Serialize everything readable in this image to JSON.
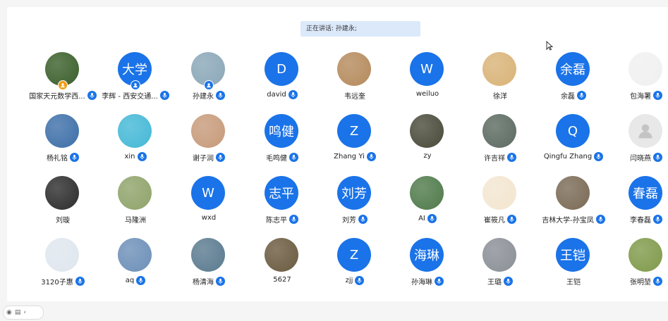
{
  "banner": {
    "speaking_text": "正在讲话: 孙建永;"
  },
  "participants": [
    {
      "name": "国家天元数学西...",
      "avatar_text": "",
      "bg": "#3a5f2a",
      "mic": true,
      "badge": "orange"
    },
    {
      "name": "李辉 - 西安交通...",
      "avatar_text": "大学",
      "bg": "#1a73e8",
      "mic": true,
      "badge": "blue"
    },
    {
      "name": "孙建永",
      "avatar_text": "",
      "bg": "#8aa7b8",
      "mic": true,
      "badge": "blue"
    },
    {
      "name": "david",
      "avatar_text": "D",
      "bg": "#1a73e8",
      "mic": true
    },
    {
      "name": "韦远奎",
      "avatar_text": "",
      "bg": "#b58a5c",
      "mic": false
    },
    {
      "name": "weiluo",
      "avatar_text": "W",
      "bg": "#1a73e8",
      "mic": false
    },
    {
      "name": "徐洋",
      "avatar_text": "",
      "bg": "#d9b377",
      "mic": false
    },
    {
      "name": "余磊",
      "avatar_text": "余磊",
      "bg": "#1a73e8",
      "mic": true
    },
    {
      "name": "包海署",
      "avatar_text": "",
      "bg": "#f0f0f0",
      "mic": true
    },
    {
      "name": "杨礼铭",
      "avatar_text": "",
      "bg": "#3d6fa8",
      "mic": true
    },
    {
      "name": "xin",
      "avatar_text": "",
      "bg": "#44b8d6",
      "mic": true
    },
    {
      "name": "谢子润",
      "avatar_text": "",
      "bg": "#c79a7a",
      "mic": true
    },
    {
      "name": "毛鸣健",
      "avatar_text": "鸣健",
      "bg": "#1a73e8",
      "mic": true
    },
    {
      "name": "Zhang Yi",
      "avatar_text": "Z",
      "bg": "#1a73e8",
      "mic": true
    },
    {
      "name": "zy",
      "avatar_text": "",
      "bg": "#4a4a3a",
      "mic": false
    },
    {
      "name": "许吉祥",
      "avatar_text": "",
      "bg": "#5b6a60",
      "mic": true
    },
    {
      "name": "Qingfu Zhang",
      "avatar_text": "Q",
      "bg": "#1a73e8",
      "mic": true
    },
    {
      "name": "闫晓燕",
      "avatar_text": "",
      "bg": "#e8e8e8",
      "mic": true
    },
    {
      "name": "刘璇",
      "avatar_text": "",
      "bg": "#2c2c2c",
      "mic": false
    },
    {
      "name": "马隆洲",
      "avatar_text": "",
      "bg": "#8fa36a",
      "mic": false
    },
    {
      "name": "wxd",
      "avatar_text": "W",
      "bg": "#1a73e8",
      "mic": false
    },
    {
      "name": "陈志平",
      "avatar_text": "志平",
      "bg": "#1a73e8",
      "mic": true
    },
    {
      "name": "刘芳",
      "avatar_text": "刘芳",
      "bg": "#1a73e8",
      "mic": true
    },
    {
      "name": "AI",
      "avatar_text": "",
      "bg": "#4f7a4a",
      "mic": true
    },
    {
      "name": "崔筱凡",
      "avatar_text": "",
      "bg": "#f3e6d0",
      "mic": true
    },
    {
      "name": "吉林大学-孙宝凤",
      "avatar_text": "",
      "bg": "#7a6a55",
      "mic": true
    },
    {
      "name": "李春磊",
      "avatar_text": "春磊",
      "bg": "#1a73e8",
      "mic": true
    },
    {
      "name": "3120子惠",
      "avatar_text": "",
      "bg": "#dfe6ee",
      "mic": true
    },
    {
      "name": "aq",
      "avatar_text": "",
      "bg": "#6d8fb8",
      "mic": true
    },
    {
      "name": "杨清海",
      "avatar_text": "",
      "bg": "#5a7a8f",
      "mic": true
    },
    {
      "name": "5627",
      "avatar_text": "",
      "bg": "#6a5a3f",
      "mic": false
    },
    {
      "name": "zjj",
      "avatar_text": "Z",
      "bg": "#1a73e8",
      "mic": true
    },
    {
      "name": "孙海琳",
      "avatar_text": "海琳",
      "bg": "#1a73e8",
      "mic": true
    },
    {
      "name": "王璐",
      "avatar_text": "",
      "bg": "#8a8f96",
      "mic": true
    },
    {
      "name": "王铠",
      "avatar_text": "王铠",
      "bg": "#1a73e8",
      "mic": false
    },
    {
      "name": "张明堃",
      "avatar_text": "",
      "bg": "#7f9a4a",
      "mic": true
    }
  ]
}
